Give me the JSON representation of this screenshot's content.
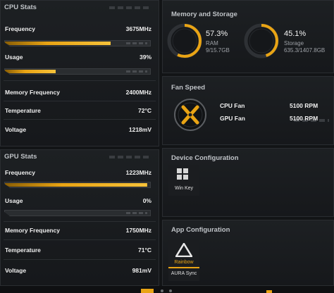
{
  "cpu": {
    "title": "CPU Stats",
    "frequency_label": "Frequency",
    "frequency_value": "3675MHz",
    "frequency_fill": 0.73,
    "usage_label": "Usage",
    "usage_value": "39%",
    "usage_fill": 0.35,
    "memfreq_label": "Memory Frequency",
    "memfreq_value": "2400MHz",
    "temp_label": "Temperature",
    "temp_value": "72°C",
    "voltage_label": "Voltage",
    "voltage_value": "1218mV"
  },
  "gpu": {
    "title": "GPU Stats",
    "frequency_label": "Frequency",
    "frequency_value": "1223MHz",
    "frequency_fill": 0.98,
    "usage_label": "Usage",
    "usage_value": "0%",
    "usage_fill": 0.0,
    "memfreq_label": "Memory Frequency",
    "memfreq_value": "1750MHz",
    "temp_label": "Temperature",
    "temp_value": "71°C",
    "voltage_label": "Voltage",
    "voltage_value": "981mV"
  },
  "memory": {
    "title": "Memory and Storage",
    "ram_percent": "57.3%",
    "ram_label": "RAM",
    "ram_detail": "9/15.7GB",
    "ram_fill": 0.573,
    "storage_percent": "45.1%",
    "storage_label": "Storage",
    "storage_detail": "635.3/1407.8GB",
    "storage_fill": 0.451
  },
  "fan": {
    "title": "Fan Speed",
    "cpu_label": "CPU Fan",
    "cpu_value": "5100 RPM",
    "gpu_label": "GPU Fan",
    "gpu_value": "5100 RPM"
  },
  "device": {
    "title": "Device Configuration",
    "win_key_label": "Win Key"
  },
  "app": {
    "title": "App Configuration",
    "rainbow_label": "Rainbow",
    "aura_label": "AURA Sync"
  },
  "colors": {
    "accent": "#e9a414",
    "panel": "#1d2023",
    "text": "#f0f0f0"
  }
}
